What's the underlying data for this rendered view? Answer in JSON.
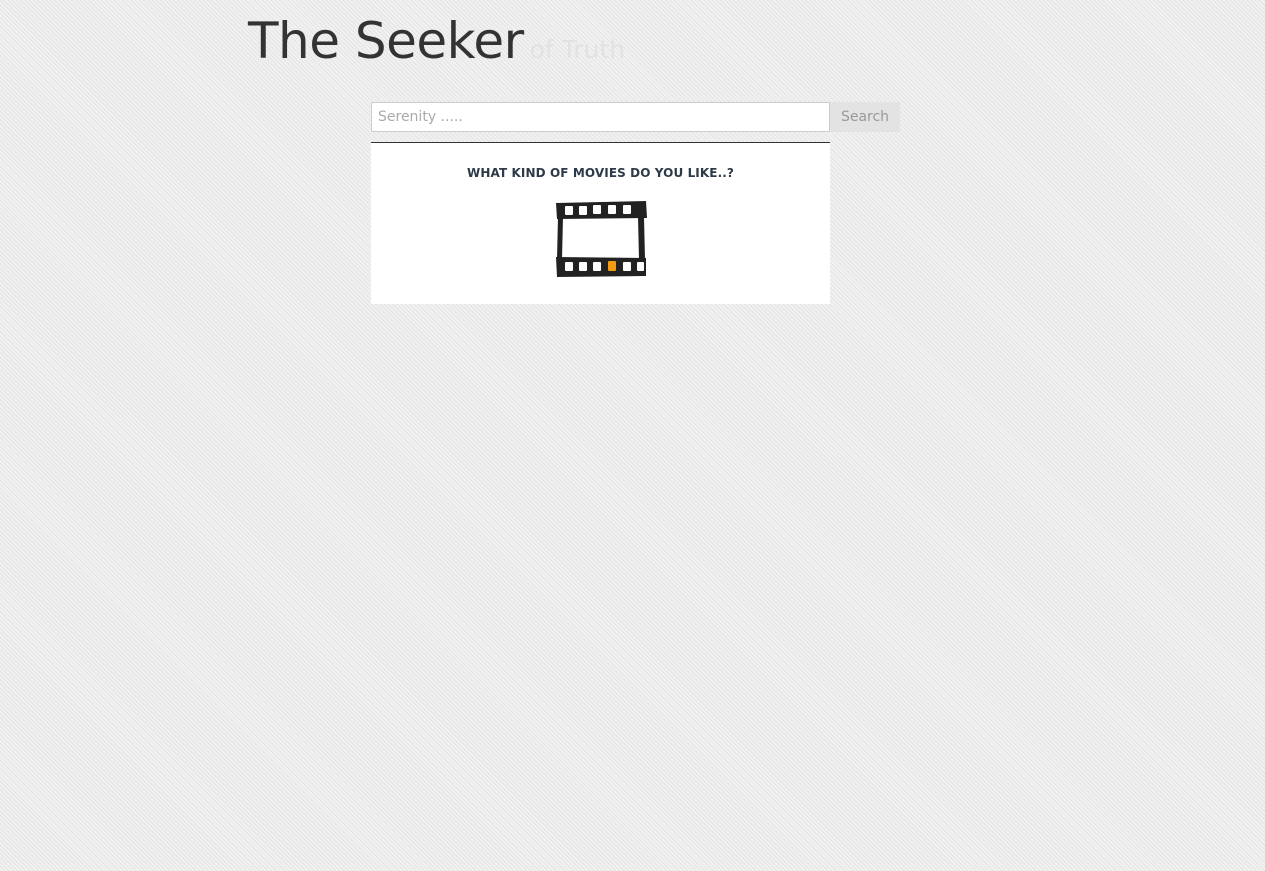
{
  "header": {
    "title": "The Seeker",
    "tagline": "of Truth"
  },
  "search": {
    "placeholder": "Serenity .....",
    "value": "",
    "button_label": "Search"
  },
  "panel": {
    "heading": "WHAT KIND OF MOVIES DO YOU LIKE..?",
    "icon": "film-strip-icon"
  },
  "colors": {
    "title": "#333333",
    "tagline": "#e2e2e2",
    "heading": "#2e3a48",
    "film_accent": "#f39c12"
  }
}
